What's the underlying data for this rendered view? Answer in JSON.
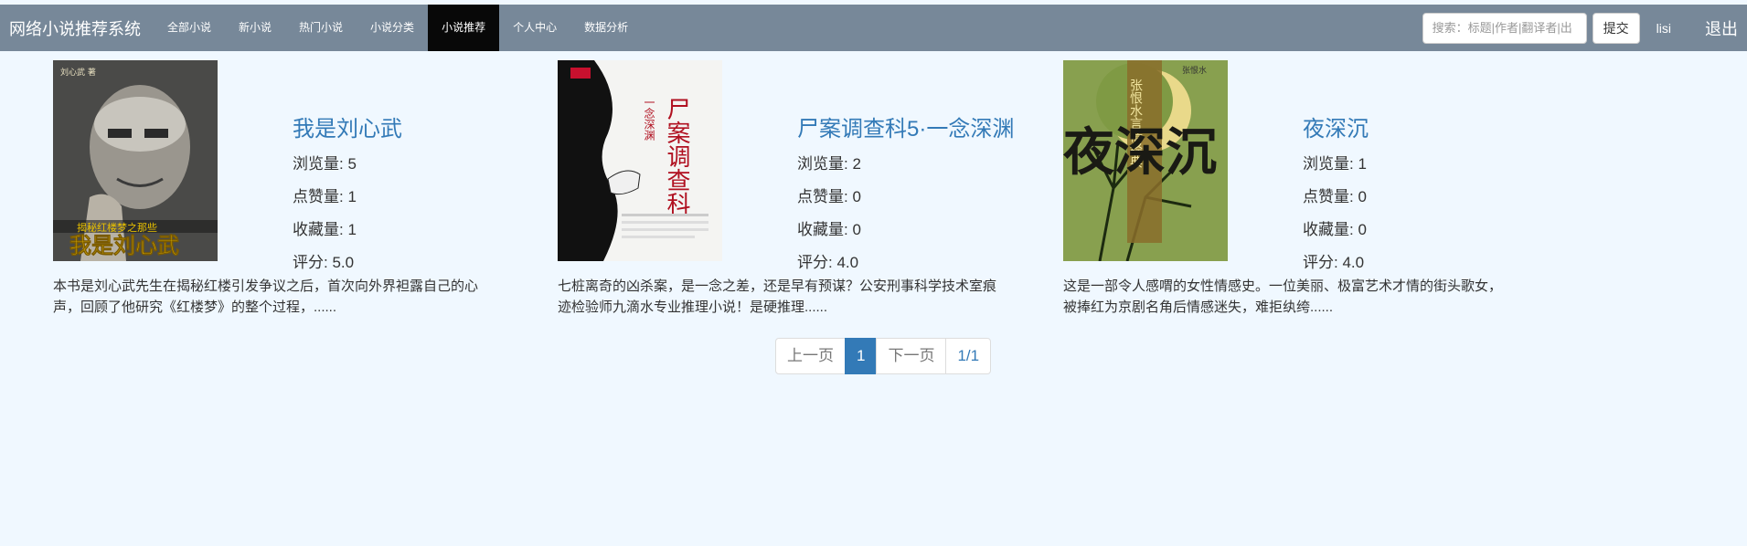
{
  "navbar": {
    "brand": "网络小说推荐系统",
    "items": [
      {
        "label": "全部小说",
        "active": false
      },
      {
        "label": "新小说",
        "active": false
      },
      {
        "label": "热门小说",
        "active": false
      },
      {
        "label": "小说分类",
        "active": false
      },
      {
        "label": "小说推荐",
        "active": true
      },
      {
        "label": "个人中心",
        "active": false
      },
      {
        "label": "数据分析",
        "active": false
      }
    ],
    "search_placeholder": "搜索：标题|作者|翻译者|出",
    "search_value": "",
    "submit_label": "提交",
    "username": "lisi",
    "logout_label": "退出"
  },
  "books": [
    {
      "title": "我是刘心武",
      "views_label": "浏览量:",
      "views": "5",
      "likes_label": "点赞量:",
      "likes": "1",
      "favorites_label": "收藏量:",
      "favorites": "1",
      "score_label": "评分:",
      "score": "5.0",
      "description": "本书是刘心武先生在揭秘红楼引发争议之后，首次向外界袒露自己的心声，回顾了他研究《红楼梦》的整个过程，......",
      "cover_text": "我是刘心武",
      "cover_top": "刘心武 著",
      "cover_sub": "揭秘红楼梦之那些"
    },
    {
      "title": "尸案调查科5·一念深渊",
      "views_label": "浏览量:",
      "views": "2",
      "likes_label": "点赞量:",
      "likes": "0",
      "favorites_label": "收藏量:",
      "favorites": "0",
      "score_label": "评分:",
      "score": "4.0",
      "description": "七桩离奇的凶杀案，是一念之差，还是早有预谋？公安刑事科学技术室痕迹检验师九滴水专业推理小说！是硬推理......",
      "cover_text": "尸案调查科",
      "cover_sub": "一念深渊"
    },
    {
      "title": "夜深沉",
      "views_label": "浏览量:",
      "views": "1",
      "likes_label": "点赞量:",
      "likes": "0",
      "favorites_label": "收藏量:",
      "favorites": "0",
      "score_label": "评分:",
      "score": "4.0",
      "description": "这是一部令人感喟的女性情感史。一位美丽、极富艺术才情的街头歌女，被捧红为京剧名角后情感迷失，难拒纨绔......",
      "cover_text": "夜深沉",
      "cover_top": "张恨水",
      "cover_sub": "张恨水言情经典"
    }
  ],
  "pagination": {
    "prev_label": "上一页",
    "current": "1",
    "next_label": "下一页",
    "total": "1/1"
  },
  "colors": {
    "navbar_bg": "#778899",
    "active_nav_bg": "#080808",
    "page_bg": "#f0f8ff",
    "link": "#337ab7"
  }
}
